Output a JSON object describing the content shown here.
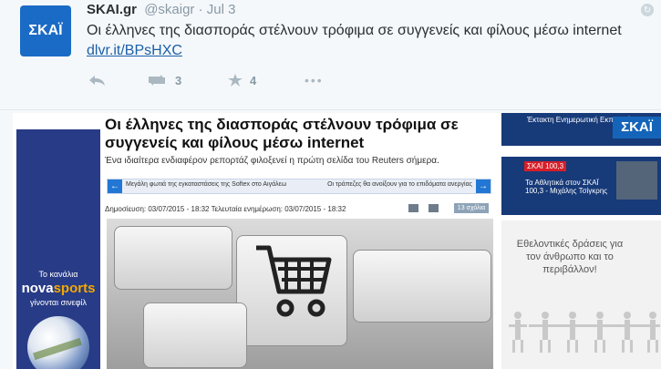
{
  "tweet": {
    "avatar_text": "ΣΚΑΪ",
    "author": "SKAI.gr",
    "handle": "@skaigr",
    "separator": "·",
    "time": "Jul 3",
    "text": "Οι έλληνες της διασποράς στέλνουν τρόφιμα σε συγγενείς και φίλους μέσω internet",
    "link": "dlvr.it/BPsHXC",
    "retweets": "3",
    "favorites": "4"
  },
  "left_ad": {
    "small": "Το κανάλια",
    "brand_nova": "nova",
    "brand_sports": "sports",
    "subtitle": "γίνονται σινεφίλ"
  },
  "article": {
    "title": "Οι έλληνες της διασποράς στέλνουν τρόφιμα σε συγγενείς και φίλους μέσω internet",
    "lead": "Ένα ιδιαίτερα ενδιαφέρον ρεπορτάζ φιλοξενεί η πρώτη σελίδα του Reuters σήμερα.",
    "prev_text": "Μεγάλη φωτιά της εγκαταστάσεις της Softex στο Αιγάλεω",
    "next_text": "Οι τράπεζες θα ανοίξουν για το επιδόματα ανεργίας",
    "published": "Δημοσίευση: 03/07/2015 - 18:32   Τελευταία ενημέρωση: 03/07/2015 - 18:32",
    "comments": "13 σχόλια"
  },
  "side": {
    "top_label": "Έκτακτη Ενημερωτική Εκπομπή",
    "logo": "ΣΚΑΪ",
    "radio_badge": "ΣΚΑΪ 100,3",
    "radio_text": "Τα Αθλητικά στον ΣΚΑΪ 100,3 - Μιχάλης Τσίγκρης",
    "volunteer": "Εθελοντικές δράσεις για τον άνθρωπο και το περιβάλλον!"
  },
  "colors": {
    "tweet_bg": "#f5f8fa",
    "link": "#1b5fa8",
    "skai_blue": "#1a6bc6",
    "dark_blue": "#173a79",
    "red": "#d71e28"
  },
  "icons": {
    "reply": "reply-icon",
    "retweet": "retweet-icon",
    "favorite": "star-icon",
    "more": "more-icon"
  }
}
